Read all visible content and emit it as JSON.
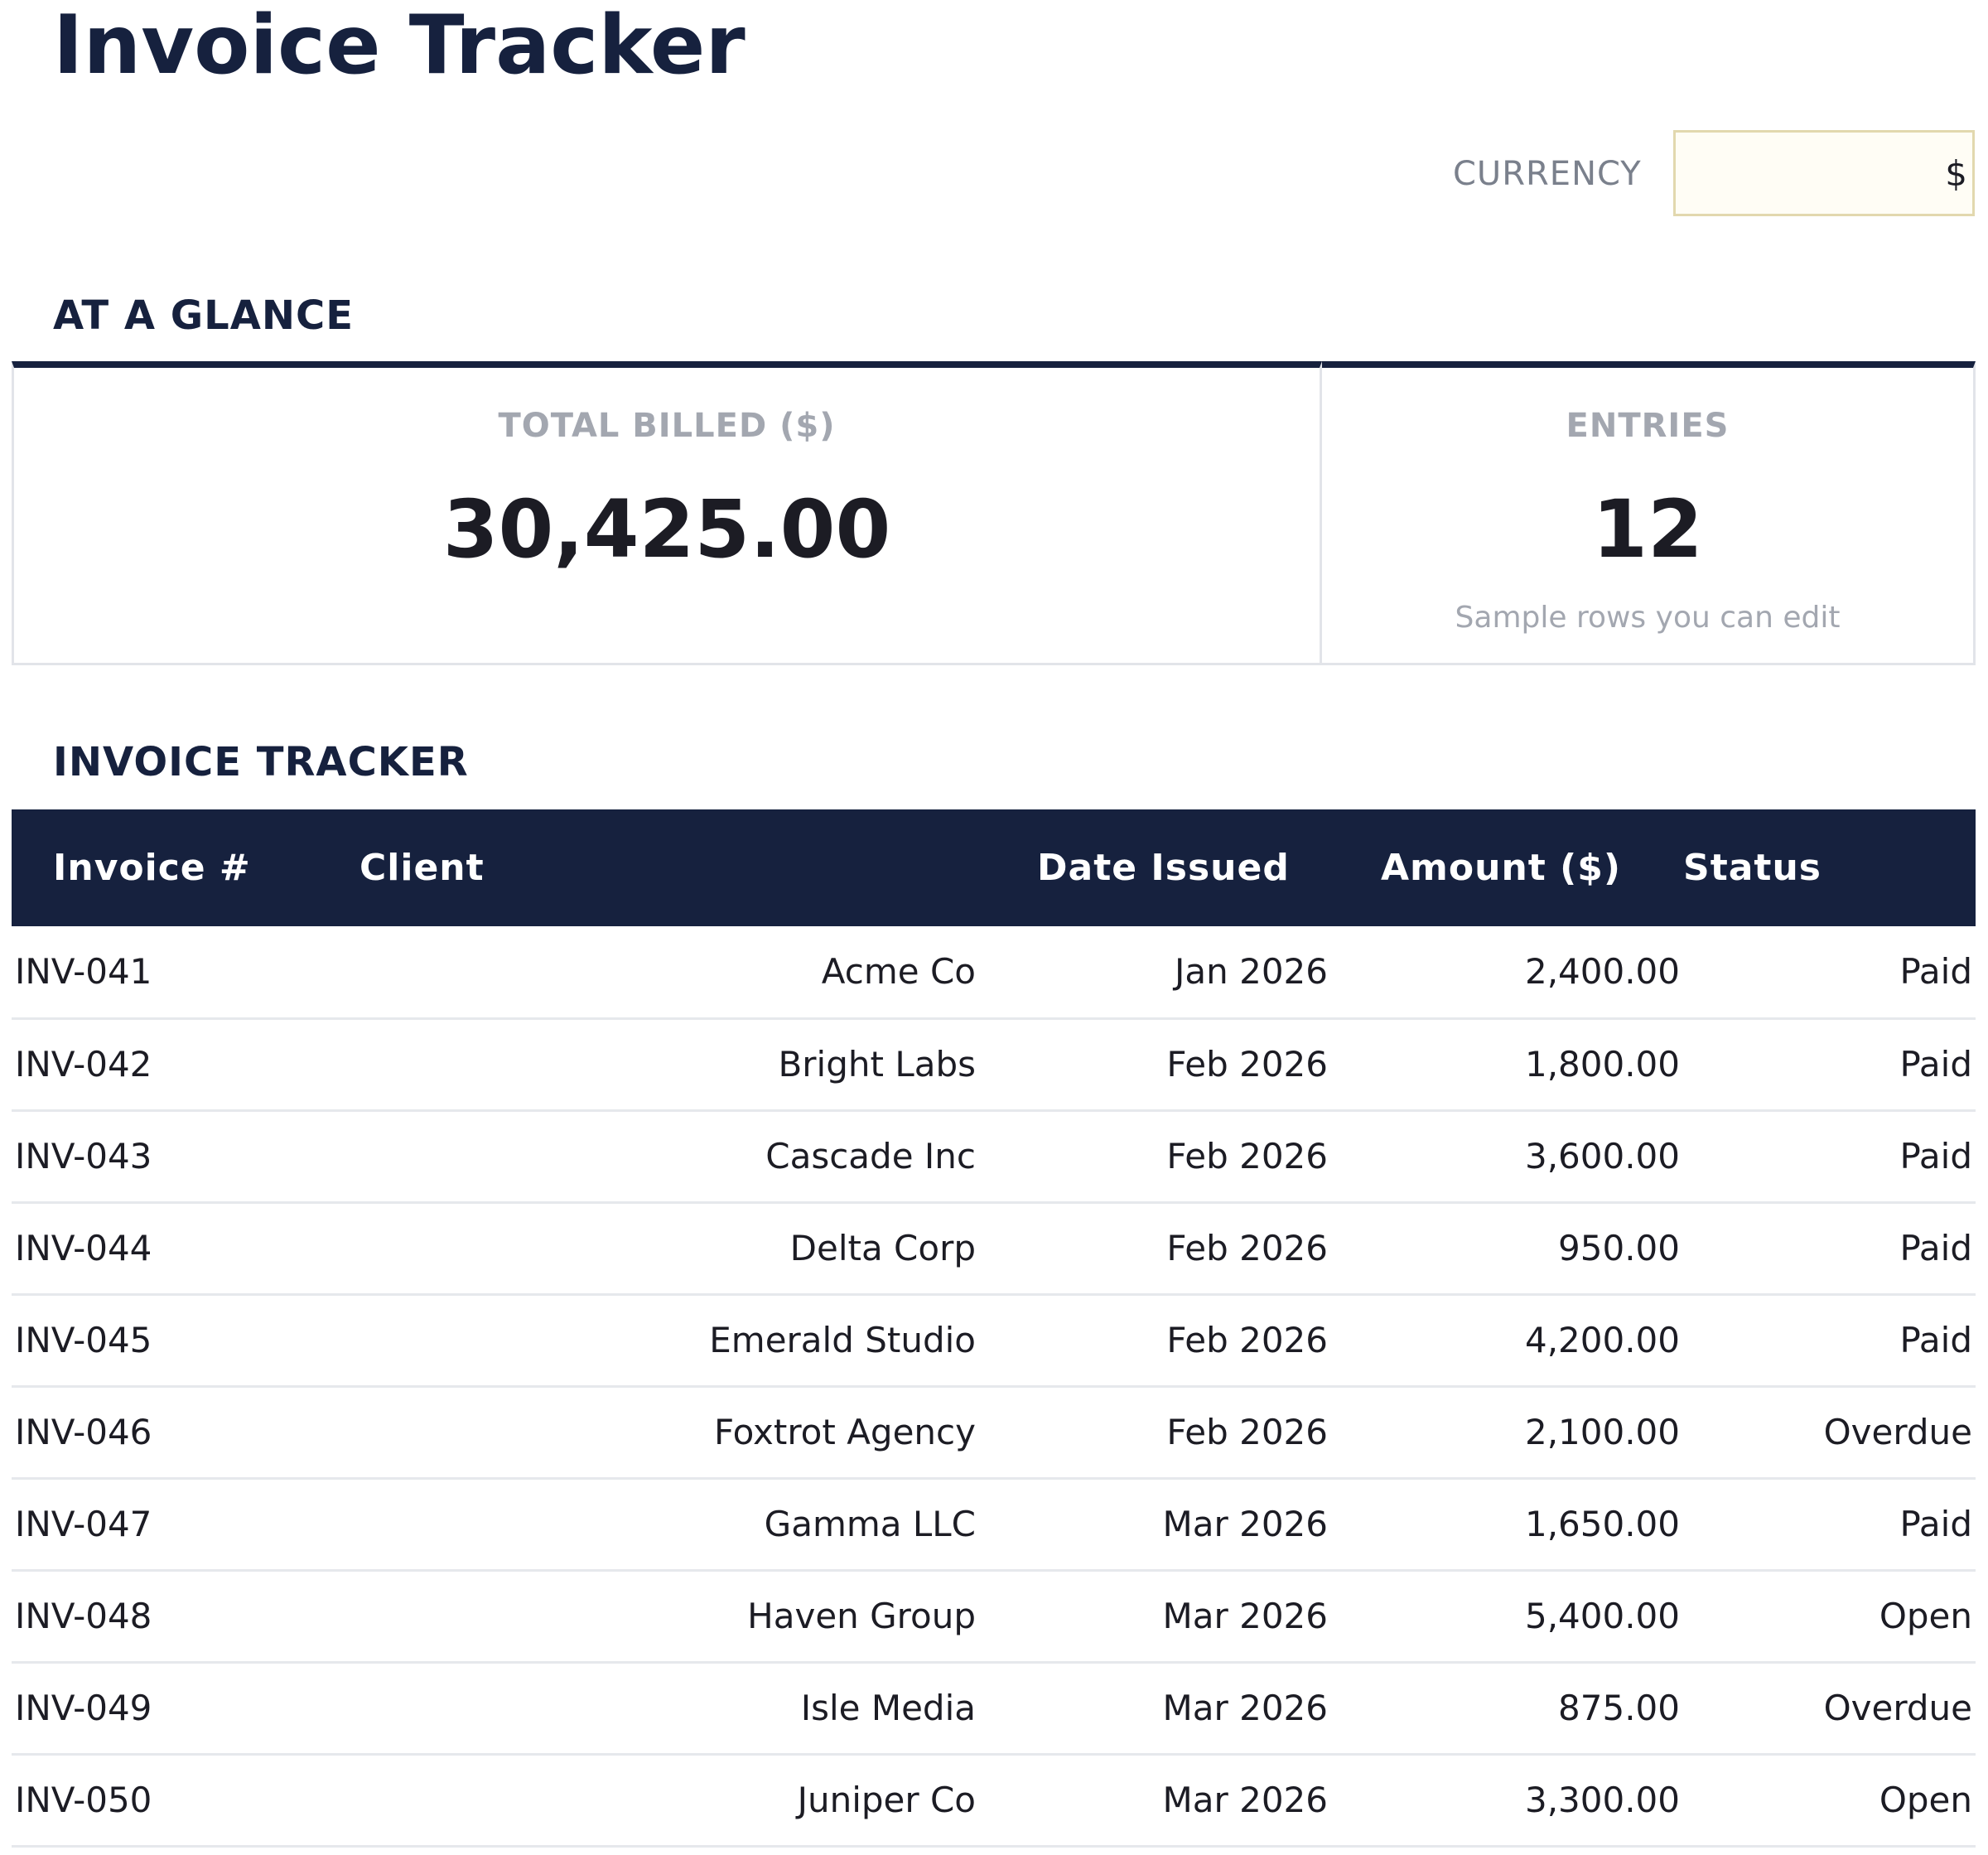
{
  "header": {
    "title": "Invoice Tracker",
    "currency_label": "CURRENCY",
    "currency_value": "$"
  },
  "glance": {
    "heading": "AT A GLANCE",
    "total_billed": {
      "label": "TOTAL BILLED ($)",
      "value": "30,425.00"
    },
    "entries": {
      "label": "ENTRIES",
      "value": "12",
      "note": "Sample rows you can edit"
    }
  },
  "tracker": {
    "heading": "INVOICE TRACKER",
    "columns": [
      "Invoice #",
      "Client",
      "Date Issued",
      "Amount ($)",
      "Status"
    ],
    "rows": [
      {
        "invoice": "INV-041",
        "client": "Acme Co",
        "date": "Jan 2026",
        "amount": "2,400.00",
        "status": "Paid"
      },
      {
        "invoice": "INV-042",
        "client": "Bright Labs",
        "date": "Feb 2026",
        "amount": "1,800.00",
        "status": "Paid"
      },
      {
        "invoice": "INV-043",
        "client": "Cascade Inc",
        "date": "Feb 2026",
        "amount": "3,600.00",
        "status": "Paid"
      },
      {
        "invoice": "INV-044",
        "client": "Delta Corp",
        "date": "Feb 2026",
        "amount": "950.00",
        "status": "Paid"
      },
      {
        "invoice": "INV-045",
        "client": "Emerald Studio",
        "date": "Feb 2026",
        "amount": "4,200.00",
        "status": "Paid"
      },
      {
        "invoice": "INV-046",
        "client": "Foxtrot Agency",
        "date": "Feb 2026",
        "amount": "2,100.00",
        "status": "Overdue"
      },
      {
        "invoice": "INV-047",
        "client": "Gamma LLC",
        "date": "Mar 2026",
        "amount": "1,650.00",
        "status": "Paid"
      },
      {
        "invoice": "INV-048",
        "client": "Haven Group",
        "date": "Mar 2026",
        "amount": "5,400.00",
        "status": "Open"
      },
      {
        "invoice": "INV-049",
        "client": "Isle Media",
        "date": "Mar 2026",
        "amount": "875.00",
        "status": "Overdue"
      },
      {
        "invoice": "INV-050",
        "client": "Juniper Co",
        "date": "Mar 2026",
        "amount": "3,300.00",
        "status": "Open"
      }
    ]
  },
  "colors": {
    "navy": "#16213e",
    "input_background": "#fffdf5",
    "input_border": "#e2d8ae",
    "muted_text": "#a3a7b0"
  }
}
